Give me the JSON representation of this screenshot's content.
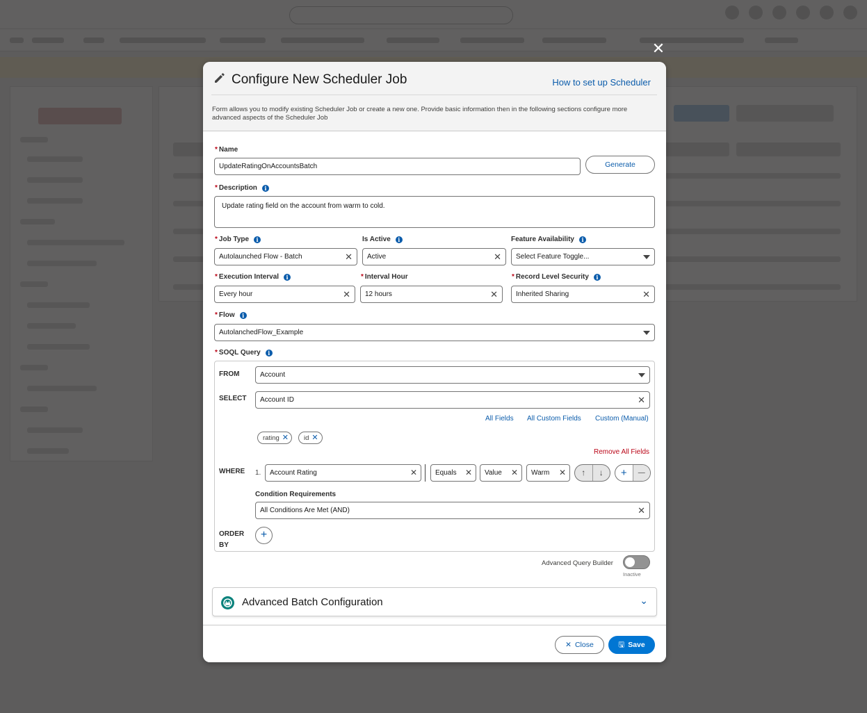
{
  "modal": {
    "close_glyph": "✕",
    "title": "Configure New Scheduler Job",
    "help_link": "How to set up Scheduler",
    "description": "Form allows you to modify existing Scheduler Job or create a new one. Provide basic information then in the following sections configure more advanced aspects of the Scheduler Job"
  },
  "form": {
    "required_mark": "*",
    "info_glyph": "i",
    "clear_glyph": "✕",
    "name": {
      "label": "Name",
      "value": "UpdateRatingOnAccountsBatch",
      "generate_label": "Generate"
    },
    "description": {
      "label": "Description",
      "value": "Update rating field on the account from warm to cold."
    },
    "job_type": {
      "label": "Job Type",
      "value": "Autolaunched Flow - Batch"
    },
    "is_active": {
      "label": "Is Active",
      "value": "Active"
    },
    "feature_availability": {
      "label": "Feature Availability",
      "placeholder": "Select Feature Toggle..."
    },
    "execution_interval": {
      "label": "Execution Interval",
      "value": "Every hour"
    },
    "interval_hour": {
      "label": "Interval Hour",
      "value": "12 hours"
    },
    "record_level_security": {
      "label": "Record Level Security",
      "value": "Inherited Sharing"
    },
    "flow": {
      "label": "Flow",
      "value": "AutolanchedFlow_Example"
    },
    "soql": {
      "label": "SOQL Query",
      "from_label": "FROM",
      "from_value": "Account",
      "select_label": "SELECT",
      "select_value": "Account ID",
      "links": [
        "All Fields",
        "All Custom Fields",
        "Custom (Manual)"
      ],
      "pills": [
        "rating",
        "id"
      ],
      "pill_remove_glyph": "✕",
      "remove_all": "Remove All Fields",
      "where_label": "WHERE",
      "where_index": "1.",
      "where_field": "Account Rating",
      "where_operator": "Equals",
      "where_type": "Value",
      "where_value": "Warm",
      "move_up_glyph": "↑",
      "move_down_glyph": "↓",
      "add_glyph": "+",
      "remove_glyph": "—",
      "condition_label": "Condition Requirements",
      "condition_value": "All Conditions Are Met (AND)",
      "order_label_1": "ORDER",
      "order_label_2": "BY"
    },
    "advanced_query": {
      "label": "Advanced Query Builder",
      "state": "Inactive"
    }
  },
  "accordion": {
    "title": "Advanced Batch Configuration",
    "chevron_glyph": "⌄"
  },
  "footer": {
    "close_label": "Close",
    "save_label": "Save",
    "close_glyph": "✕",
    "save_glyph": "🖫"
  },
  "colors": {
    "brand": "#0176d3",
    "link": "#0b5cab",
    "required": "#ba0517"
  }
}
